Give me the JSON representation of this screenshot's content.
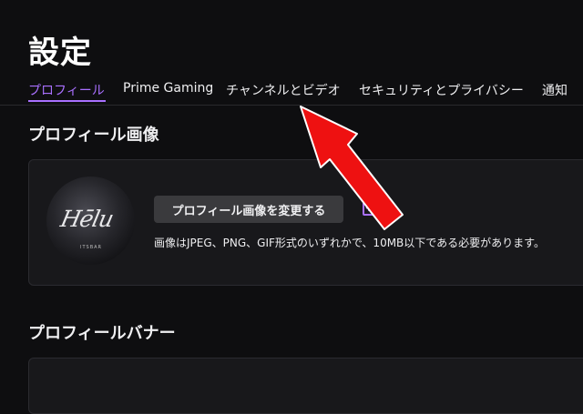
{
  "page": {
    "title": "設定"
  },
  "tabs": [
    {
      "label": "プロフィール",
      "active": true
    },
    {
      "label": "Prime Gaming",
      "active": false
    },
    {
      "label": "チャンネルとビデオ",
      "active": false
    },
    {
      "label": "セキュリティとプライバシー",
      "active": false
    },
    {
      "label": "通知",
      "active": false
    }
  ],
  "profile_image": {
    "section_title": "プロフィール画像",
    "change_button": "プロフィール画像を変更する",
    "help_text": "画像はJPEG、PNG、GIF形式のいずれかで、10MB以下である必要があります。",
    "avatar_text": "Hēlu",
    "avatar_caption": "ITSBAR"
  },
  "profile_banner": {
    "section_title": "プロフィールバナー"
  },
  "colors": {
    "background": "#0e0e10",
    "card": "#18181b",
    "accent": "#a970ff",
    "button": "#3a3a3d",
    "arrow": "#ee1111"
  }
}
